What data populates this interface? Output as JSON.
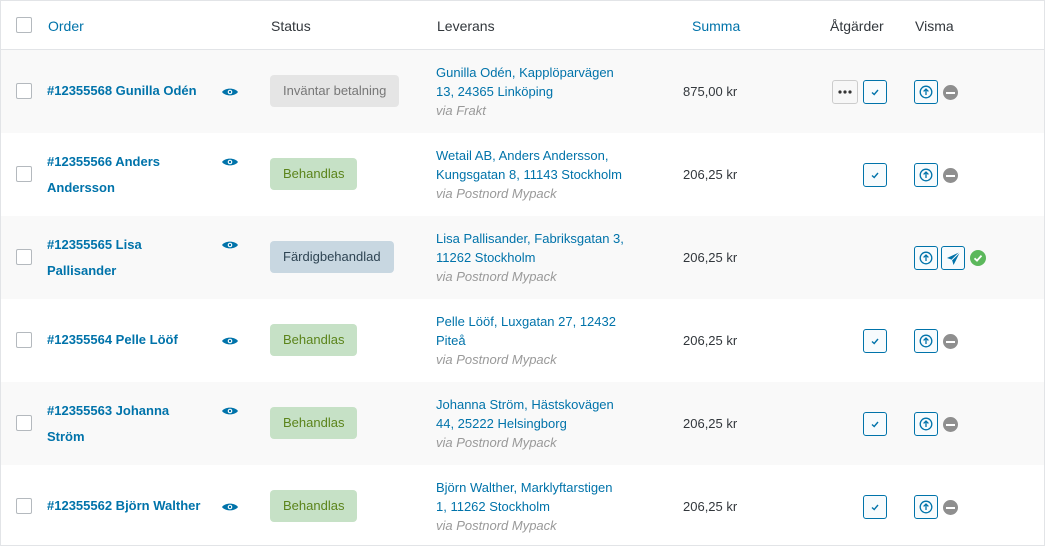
{
  "header": {
    "order": "Order",
    "status": "Status",
    "shipping": "Leverans",
    "total": "Summa",
    "actions": "Åtgärder",
    "visma": "Visma"
  },
  "rows": [
    {
      "order": "#12355568 Gunilla Odén",
      "status": "Inväntar betalning",
      "ship_line1": "Gunilla Odén, Kapplöparvägen",
      "ship_line2": "13, 24365 Linköping",
      "via": "via Frakt",
      "total": "875,00 kr"
    },
    {
      "order_line1": "#12355566 Anders",
      "order_line2": "Andersson",
      "status": "Behandlas",
      "ship_line1": "Wetail AB, Anders Andersson,",
      "ship_line2": "Kungsgatan 8, 11143 Stockholm",
      "via": "via Postnord Mypack",
      "total": "206,25 kr"
    },
    {
      "order_line1": "#12355565 Lisa",
      "order_line2": "Pallisander",
      "status": "Färdigbehandlad",
      "ship_line1": "Lisa Pallisander, Fabriksgatan 3,",
      "ship_line2": "11262 Stockholm",
      "via": "via Postnord Mypack",
      "total": "206,25 kr"
    },
    {
      "order": "#12355564 Pelle Lööf",
      "status": "Behandlas",
      "ship_line1": "Pelle Lööf, Luxgatan 27, 12432",
      "ship_line2": "Piteå",
      "via": "via Postnord Mypack",
      "total": "206,25 kr"
    },
    {
      "order_line1": "#12355563 Johanna",
      "order_line2": "Ström",
      "status": "Behandlas",
      "ship_line1": "Johanna Ström, Hästskovägen",
      "ship_line2": "44, 25222 Helsingborg",
      "via": "via Postnord Mypack",
      "total": "206,25 kr"
    },
    {
      "order": "#12355562 Björn Walther",
      "status": "Behandlas",
      "ship_line1": "Björn Walther, Marklyftarstigen",
      "ship_line2": "1, 11262 Stockholm",
      "via": "via Postnord Mypack",
      "total": "206,25 kr"
    }
  ],
  "icons": {
    "preview": "eye-icon",
    "more": "more-dots-icon",
    "complete": "checkmark-icon",
    "upload": "upload-arrow-icon",
    "send": "paper-plane-icon",
    "not_synced": "minus-circle-icon",
    "synced": "check-circle-icon"
  },
  "colors": {
    "link": "#0073aa",
    "pending_bg": "#e5e5e5",
    "processing_bg": "#c6e1c6",
    "completed_bg": "#c8d7e1",
    "synced": "#5cb85c"
  }
}
